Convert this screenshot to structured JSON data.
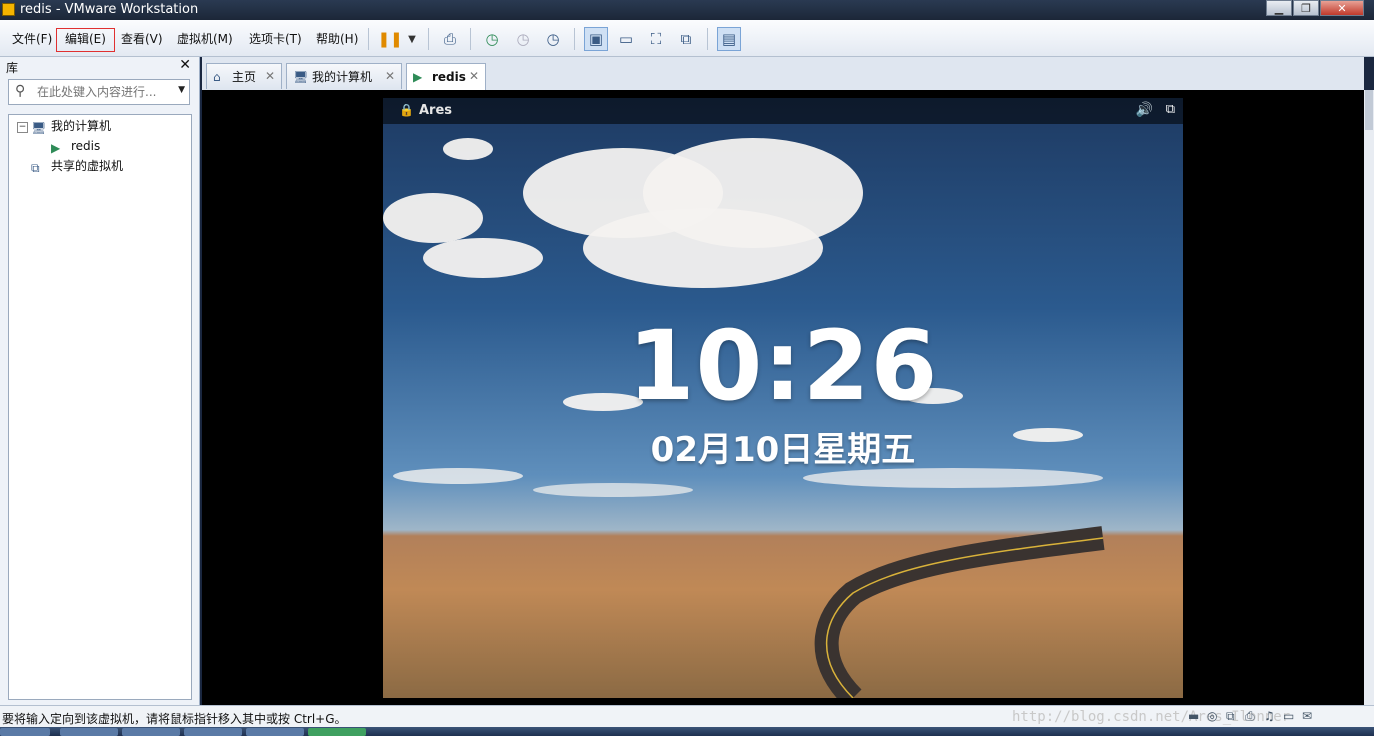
{
  "window": {
    "title": "redis - VMware Workstation",
    "buttons": {
      "minimize": "▁",
      "restore": "❐",
      "close": "✕"
    }
  },
  "menu": [
    "文件(F)",
    "编辑(E)",
    "查看(V)",
    "虚拟机(M)",
    "选项卡(T)",
    "帮助(H)"
  ],
  "library": {
    "title": "库",
    "close": "✕",
    "search_placeholder": "在此处键入内容进行...",
    "tree": {
      "expander": "−",
      "root": "我的计算机",
      "child": "redis",
      "shared": "共享的虚拟机"
    }
  },
  "tabs": [
    {
      "label": "主页",
      "icon": "home-icon",
      "close": "✕"
    },
    {
      "label": "我的计算机",
      "icon": "computer-icon",
      "close": "✕"
    },
    {
      "label": "redis",
      "icon": "vm-icon",
      "close": "✕"
    }
  ],
  "vm_screen": {
    "user": "Ares",
    "time": "10:26",
    "date": "02月10日星期五"
  },
  "status": {
    "message": "要将输入定向到该虚拟机，请将鼠标指针移入其中或按 Ctrl+G。",
    "watermark": "http://blog.csdn.net/Ares_Ilonner"
  },
  "colors": {
    "accent": "#3a5b85",
    "highlight_border": "#e03030"
  }
}
